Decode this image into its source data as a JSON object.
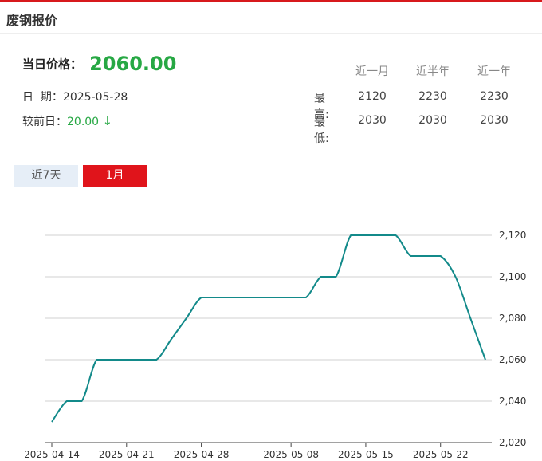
{
  "header": {
    "title": "废钢报价"
  },
  "today": {
    "label": "当日价格：",
    "price": "2060.00",
    "date_label": "日  期：",
    "date": "2025-05-28",
    "diff_label": "较前日：",
    "diff_value": "20.00",
    "diff_arrow": "↓"
  },
  "stats": {
    "headers": [
      "近一月",
      "近半年",
      "近一年"
    ],
    "rows": [
      {
        "label": "最高:",
        "values": [
          "2120",
          "2230",
          "2230"
        ]
      },
      {
        "label": "最低:",
        "values": [
          "2030",
          "2030",
          "2030"
        ]
      }
    ]
  },
  "tabs": [
    {
      "label": "近7天",
      "active": false
    },
    {
      "label": "1月",
      "active": true
    }
  ],
  "colors": {
    "accent_red": "#e0141b",
    "price_green": "#27a844",
    "line": "#138a8a"
  },
  "chart_data": {
    "type": "line",
    "title": "",
    "xlabel": "",
    "ylabel": "",
    "ylim": [
      2020,
      2120
    ],
    "yticks": [
      "2,020",
      "2,040",
      "2,060",
      "2,080",
      "2,100",
      "2,120"
    ],
    "ytick_values": [
      2020,
      2040,
      2060,
      2080,
      2100,
      2120
    ],
    "xtick_labels": [
      "2025-04-14",
      "2025-04-21",
      "2025-04-28",
      "2025-05-08",
      "2025-05-15",
      "2025-05-22"
    ],
    "xtick_index": [
      0,
      5,
      10,
      16,
      21,
      26
    ],
    "grid": true,
    "series": [
      {
        "values": [
          2030,
          2040,
          2040,
          2060,
          2060,
          2060,
          2060,
          2060,
          2070,
          2080,
          2090,
          2090,
          2090,
          2090,
          2090,
          2090,
          2090,
          2090,
          2100,
          2100,
          2120,
          2120,
          2120,
          2120,
          2110,
          2110,
          2110,
          2100,
          2080,
          2060
        ]
      }
    ]
  }
}
